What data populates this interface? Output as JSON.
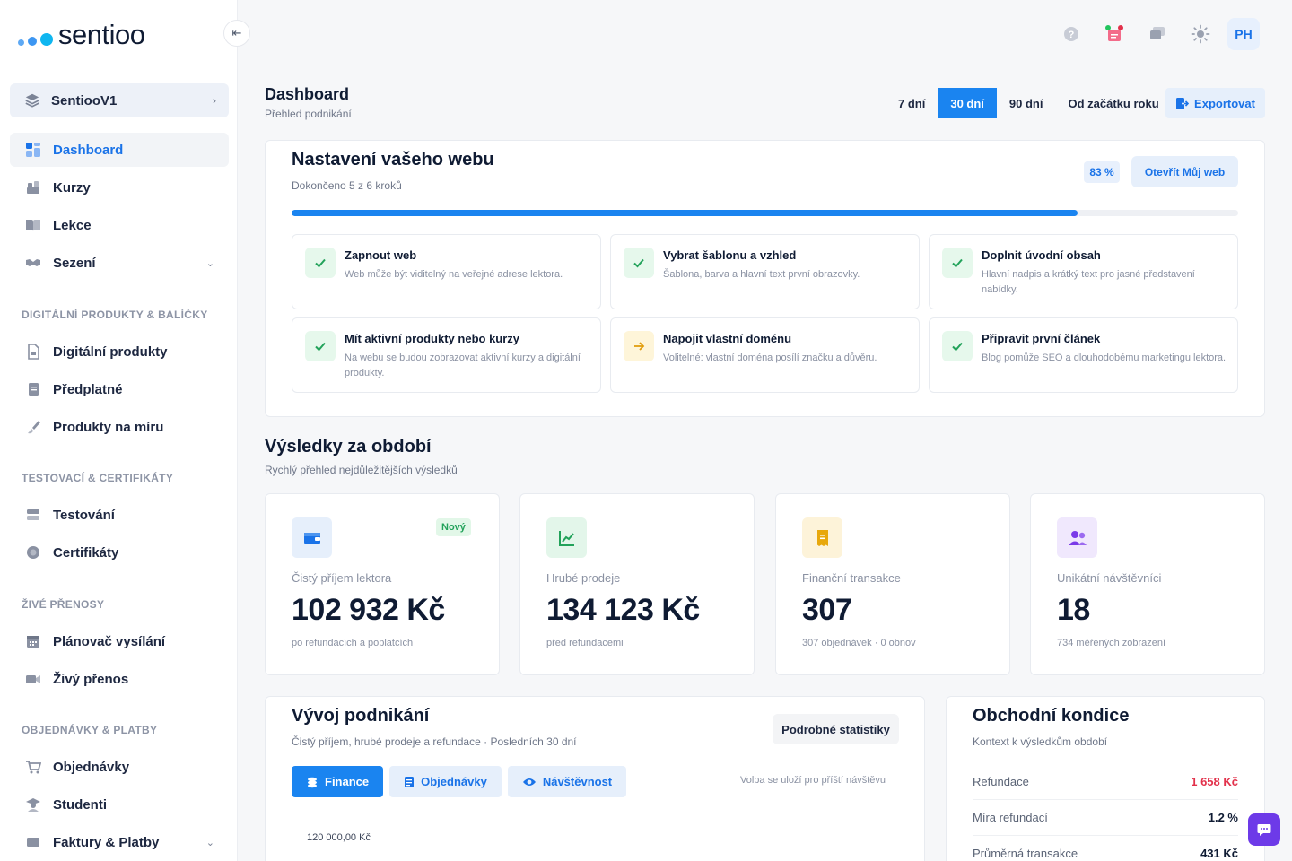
{
  "brand": {
    "name": "sentioo"
  },
  "sidebar": {
    "workspace": "SentiooV1",
    "items_top": [
      {
        "label": "Dashboard"
      },
      {
        "label": "Kurzy"
      },
      {
        "label": "Lekce"
      },
      {
        "label": "Sezení"
      }
    ],
    "sections": [
      {
        "title": "DIGITÁLNÍ PRODUKTY & BALÍČKY",
        "items": [
          "Digitální produkty",
          "Předplatné",
          "Produkty na míru"
        ]
      },
      {
        "title": "TESTOVACÍ & CERTIFIKÁTY",
        "items": [
          "Testování",
          "Certifikáty"
        ]
      },
      {
        "title": "ŽIVÉ PŘENOSY",
        "items": [
          "Plánovač vysílání",
          "Živý přenos"
        ]
      },
      {
        "title": "OBJEDNÁVKY & PLATBY",
        "items": [
          "Objednávky",
          "Studenti",
          "Faktury & Platby"
        ]
      }
    ]
  },
  "header": {
    "avatar_initials": "PH"
  },
  "page": {
    "title": "Dashboard",
    "subtitle": "Přehled podnikání"
  },
  "range": {
    "options": [
      "7 dní",
      "30 dní",
      "90 dní",
      "Od začátku roku"
    ],
    "selected": "30 dní",
    "export": "Exportovat"
  },
  "setup": {
    "title": "Nastavení vašeho webu",
    "subtitle": "Dokončeno 5 z 6 kroků",
    "percent_label": "83 %",
    "percent": 83,
    "open_button": "Otevřít Můj web",
    "steps": [
      {
        "title": "Zapnout web",
        "desc": "Web může být viditelný na veřejné adrese lektora.",
        "done": true
      },
      {
        "title": "Vybrat šablonu a vzhled",
        "desc": "Šablona, barva a hlavní text první obrazovky.",
        "done": true
      },
      {
        "title": "Doplnit úvodní obsah",
        "desc": "Hlavní nadpis a krátký text pro jasné představení nabídky.",
        "done": true
      },
      {
        "title": "Mít aktivní produkty nebo kurzy",
        "desc": "Na webu se budou zobrazovat aktivní kurzy a digitální produkty.",
        "done": true
      },
      {
        "title": "Napojit vlastní doménu",
        "desc": "Volitelné: vlastní doména posílí značku a důvěru.",
        "done": false
      },
      {
        "title": "Připravit první článek",
        "desc": "Blog pomůže SEO a dlouhodobému marketingu lektora.",
        "done": true
      }
    ]
  },
  "results": {
    "title": "Výsledky za období",
    "subtitle": "Rychlý přehled nejdůležitějších výsledků",
    "kpis": [
      {
        "label": "Čistý příjem lektora",
        "value": "102 932 Kč",
        "note": "po refundacích a poplatcích",
        "badge": "Nový",
        "icon": "wallet-icon",
        "color": "#1a73e8"
      },
      {
        "label": "Hrubé prodeje",
        "value": "134 123 Kč",
        "note": "před refundacemi",
        "icon": "trend-up-icon",
        "color": "#22a25a"
      },
      {
        "label": "Finanční transakce",
        "value": "307",
        "note": "307 objednávek · 0 obnov",
        "icon": "receipt-icon",
        "color": "#e8a80c"
      },
      {
        "label": "Unikátní návštěvníci",
        "value": "18",
        "note": "734 měřených zobrazení",
        "icon": "users-icon",
        "color": "#7a3be8"
      }
    ]
  },
  "development": {
    "title": "Vývoj podnikání",
    "subtitle": "Čistý příjem, hrubé prodeje a refundace · Posledních 30 dní",
    "details_button": "Podrobné statistiky",
    "tabs": [
      "Finance",
      "Objednávky",
      "Návštěvnost"
    ],
    "selected_tab": "Finance",
    "save_note": "Volba se uloží pro příští návštěvu",
    "y_tick_top": "120 000,00 Kč"
  },
  "health": {
    "title": "Obchodní kondice",
    "subtitle": "Kontext k výsledkům období",
    "rows": [
      {
        "label": "Refundace",
        "value": "1 658 Kč"
      },
      {
        "label": "Míra refundací",
        "value": "1.2 %"
      },
      {
        "label": "Průměrná transakce",
        "value": "431 Kč"
      }
    ]
  }
}
